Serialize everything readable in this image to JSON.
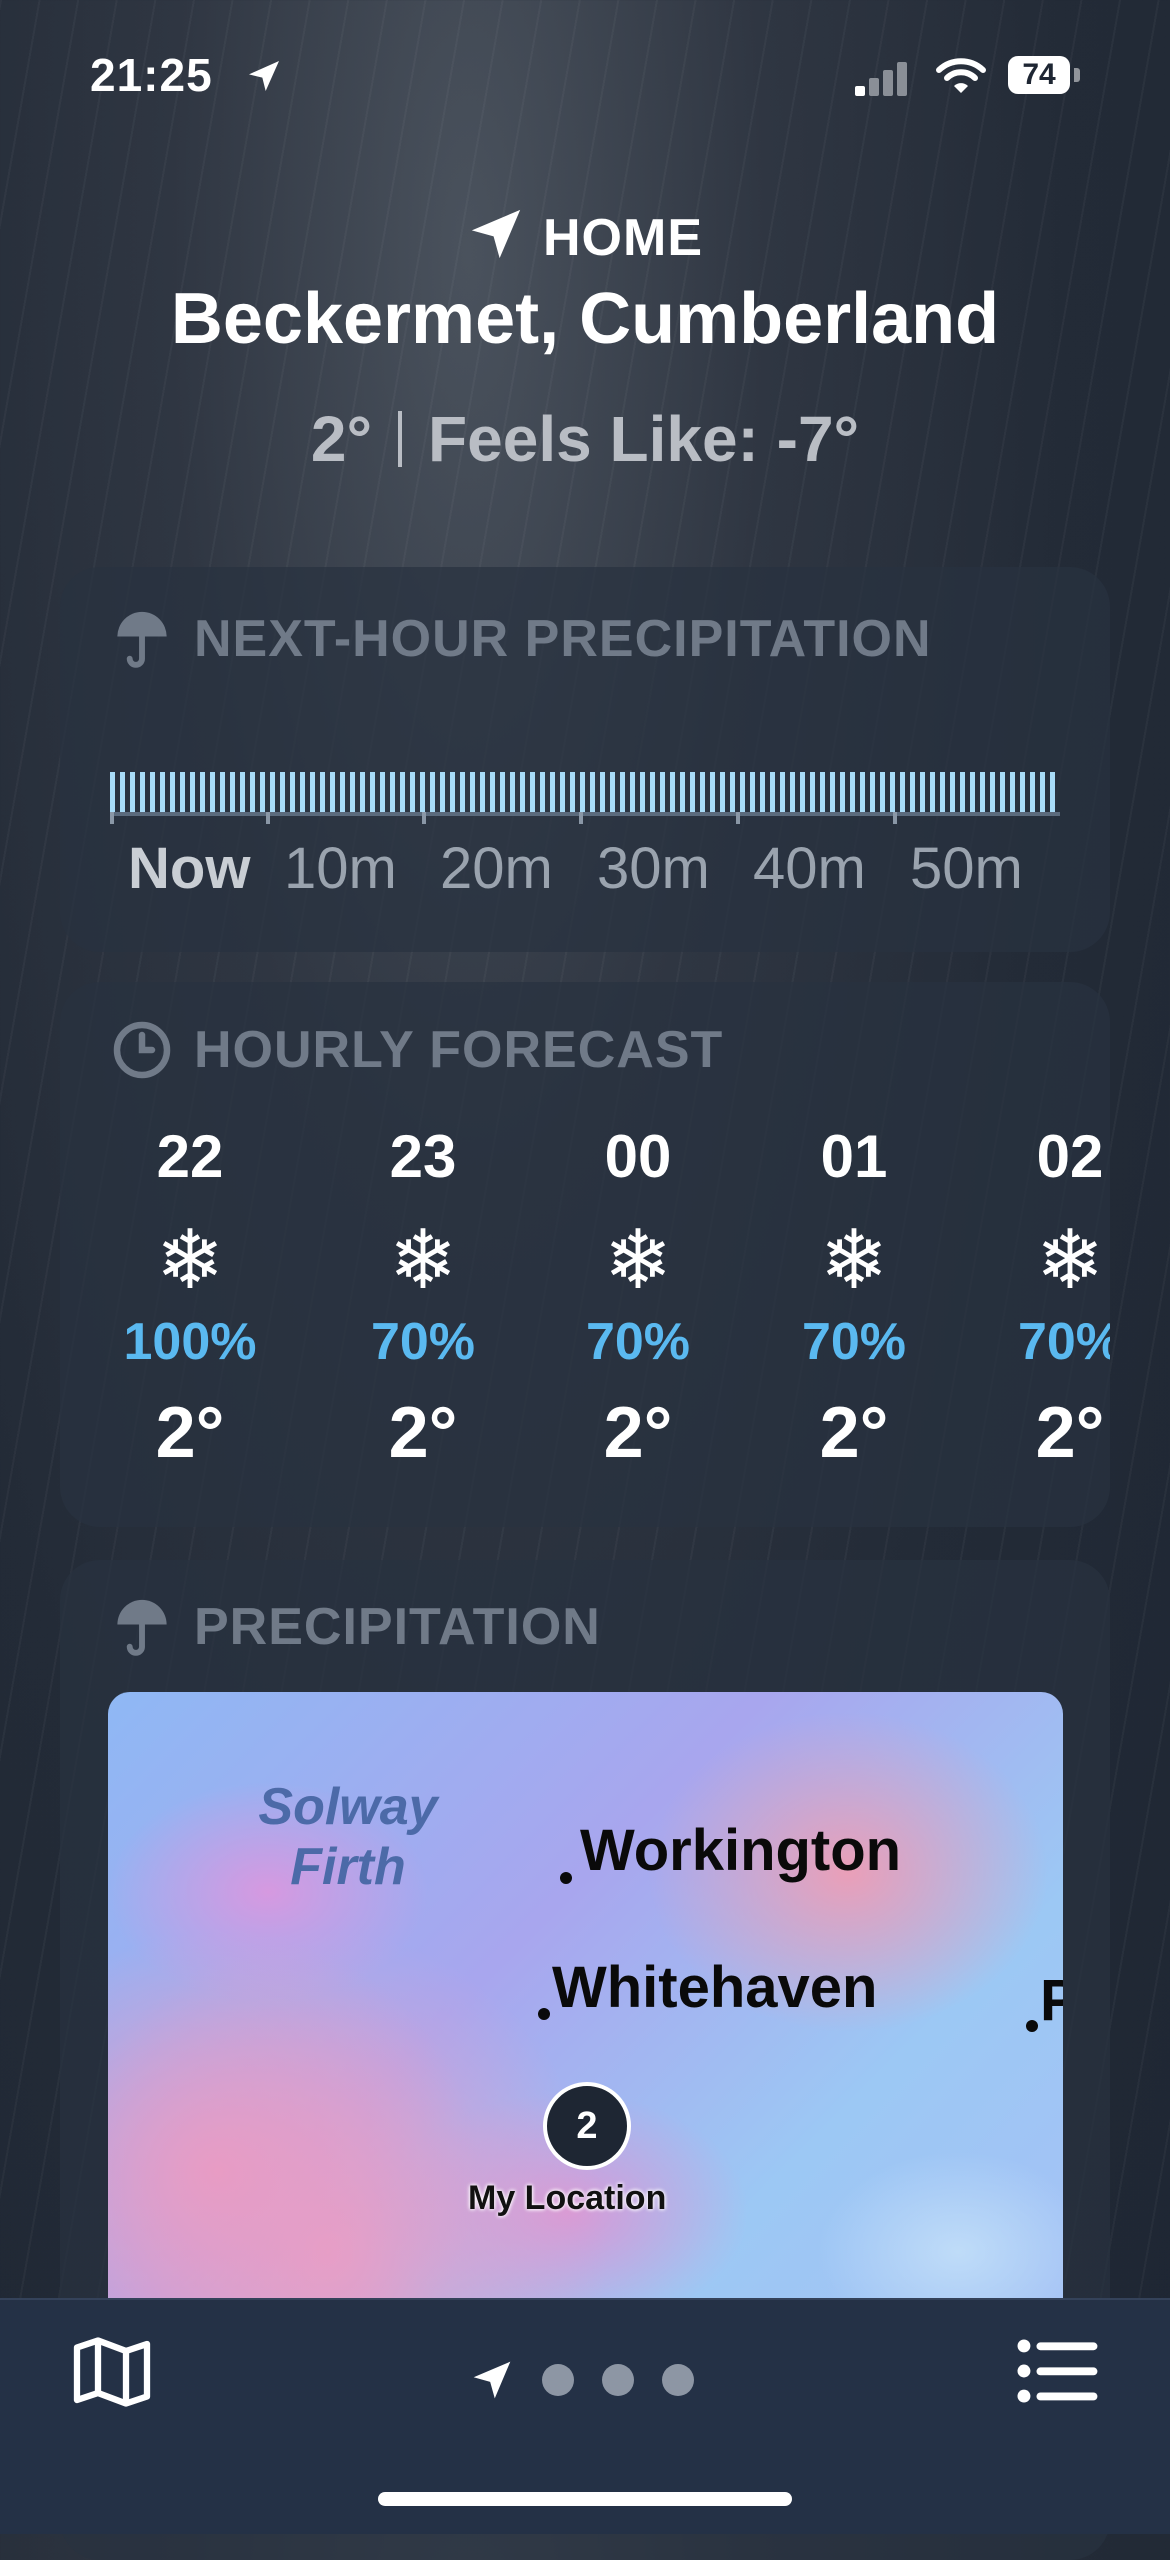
{
  "status_bar": {
    "time": "21:25",
    "battery": "74"
  },
  "header": {
    "home_label": "HOME",
    "city": "Beckermet, Cumberland",
    "temperature": "2°",
    "feels_like": "Feels Like: -7°"
  },
  "next_hour": {
    "title": "NEXT-HOUR PRECIPITATION",
    "labels": [
      "Now",
      "10m",
      "20m",
      "30m",
      "40m",
      "50m"
    ]
  },
  "hourly": {
    "title": "HOURLY FORECAST",
    "hours": [
      {
        "hour": "22",
        "icon": "snowflake",
        "chance": "100%",
        "temp": "2°"
      },
      {
        "hour": "23",
        "icon": "snowflake",
        "chance": "70%",
        "temp": "2°"
      },
      {
        "hour": "00",
        "icon": "snowflake",
        "chance": "70%",
        "temp": "2°"
      },
      {
        "hour": "01",
        "icon": "snowflake",
        "chance": "70%",
        "temp": "2°"
      },
      {
        "hour": "02",
        "icon": "snowflake",
        "chance": "70%",
        "temp": "2°"
      }
    ]
  },
  "precip_map": {
    "title": "PRECIPITATION",
    "sea_label_line1": "Solway",
    "sea_label_line2": "Firth",
    "towns": [
      "Workington",
      "Whitehaven",
      "P"
    ],
    "pin_value": "2",
    "pin_label": "My Location"
  },
  "colors": {
    "precip_blue": "#5ab9f0",
    "tick_blue": "#a8dcf8",
    "background": "#232b37"
  },
  "icons": [
    "location-arrow-icon",
    "umbrella-icon",
    "clock-icon",
    "snowflake-icon",
    "map-icon",
    "list-icon"
  ]
}
